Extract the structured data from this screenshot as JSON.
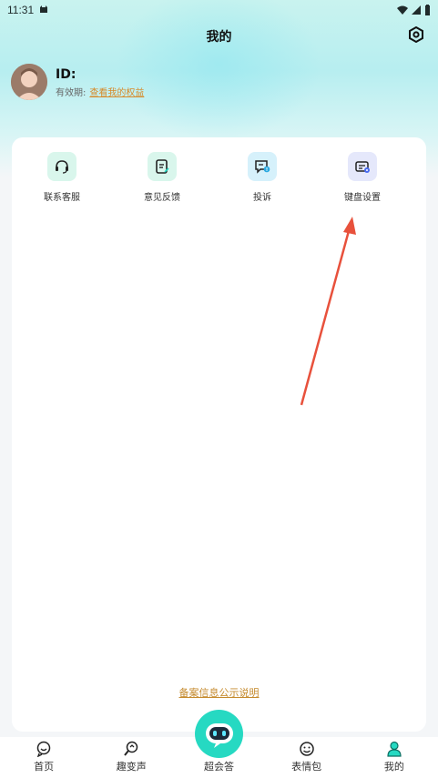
{
  "status_bar": {
    "time": "11:31"
  },
  "header": {
    "title": "我的"
  },
  "profile": {
    "id_label": "ID:",
    "validity_label": "有效期:",
    "benefits_link": "查看我的权益"
  },
  "menu": [
    {
      "label": "联系客服",
      "icon": "headset-icon",
      "bg": "#d9f6ec"
    },
    {
      "label": "意见反馈",
      "icon": "feedback-icon",
      "bg": "#d9f6ec"
    },
    {
      "label": "投诉",
      "icon": "complaint-icon",
      "bg": "#d6f1fb"
    },
    {
      "label": "键盘设置",
      "icon": "keyboard-settings-icon",
      "bg": "#e5e8fb"
    }
  ],
  "footer": {
    "record_link": "备案信息公示说明"
  },
  "tabs": [
    {
      "label": "首页",
      "icon": "home-icon"
    },
    {
      "label": "趣变声",
      "icon": "voice-change-icon"
    },
    {
      "label": "超会答",
      "icon": "robot-icon"
    },
    {
      "label": "表情包",
      "icon": "emoji-icon"
    },
    {
      "label": "我的",
      "icon": "profile-icon"
    }
  ],
  "colors": {
    "accent": "#26d9c2",
    "link": "#d68a2a",
    "arrow": "#e8513c"
  }
}
